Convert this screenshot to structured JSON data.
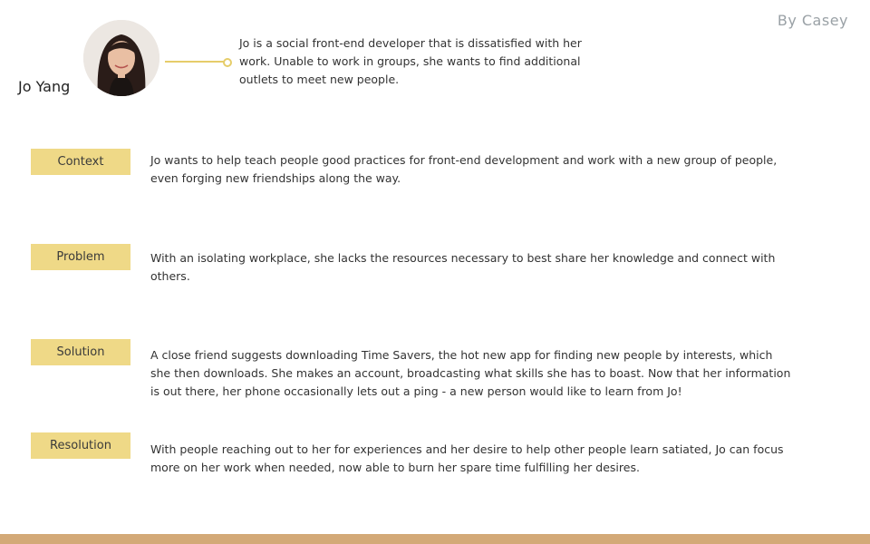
{
  "author": "By Casey",
  "persona": {
    "name": "Jo Yang",
    "bio": "Jo is a social front-end developer that is dissatisfied with her work. Unable to work in groups, she wants to find additional outlets to meet new people."
  },
  "sections": [
    {
      "label": "Context",
      "text": "Jo wants to help teach people good practices for front-end development and work with a new group of people, even forging new friendships along the way."
    },
    {
      "label": "Problem",
      "text": "With an isolating workplace, she lacks the resources necessary to best share her knowledge and connect with others."
    },
    {
      "label": "Solution",
      "text": "A close friend suggests downloading Time Savers, the hot new app for finding new people by interests, which she then downloads. She makes an account, broadcasting what skills she has to boast. Now that her information is out there, her phone occasionally lets out a ping - a new person would like to learn from Jo!"
    },
    {
      "label": "Resolution",
      "text": "With people reaching out to her for experiences and her desire to help other people learn satiated, Jo can focus more on her work when needed,  now able to burn her spare time fulfilling her desires."
    }
  ],
  "colors": {
    "label_background": "#efd987",
    "connector": "#e6cd6a",
    "bottom_bar": "#d3a977",
    "author_text": "#9aa1a6"
  }
}
